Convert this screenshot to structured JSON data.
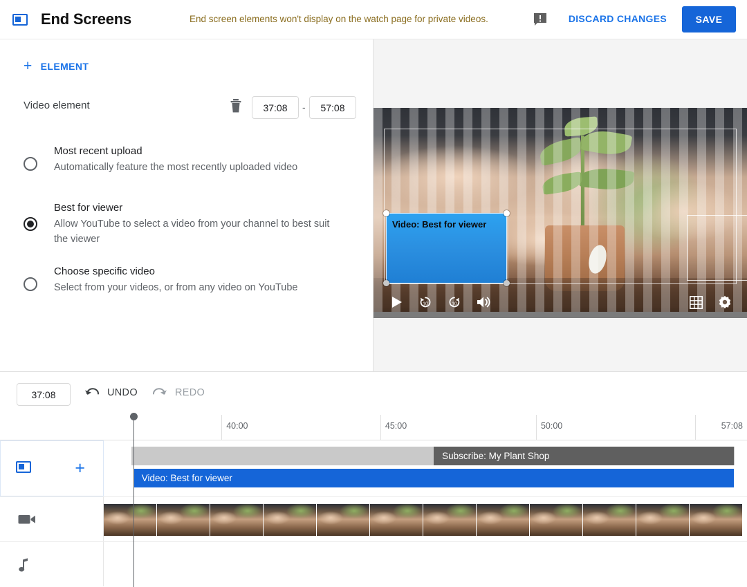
{
  "header": {
    "icon": "end-screen-icon",
    "title": "End Screens",
    "warning_text": "End screen elements won't display on the watch page for private videos.",
    "warning_icon": "comment-alert-icon",
    "discard_label": "DISCARD CHANGES",
    "save_label": "SAVE",
    "accent_color": "#1565d8",
    "warning_color": "#8a6d1f",
    "link_color": "#1a73e8"
  },
  "editor": {
    "add_element_label": "ELEMENT",
    "add_element_icon": "plus-icon",
    "element_name": "Video element",
    "delete_icon": "trash-icon",
    "start_time": "37:08",
    "time_separator": "-",
    "end_time": "57:08",
    "options": [
      {
        "title": "Most recent upload",
        "description": "Automatically feature the most recently uploaded video",
        "selected": false
      },
      {
        "title": "Best for viewer",
        "description": "Allow YouTube to select a video from your channel to best suit the viewer",
        "selected": true
      },
      {
        "title": "Choose specific video",
        "description": "Select from your videos, or from any video on YouTube",
        "selected": false
      }
    ]
  },
  "preview": {
    "selected_element_label": "Video: Best for viewer",
    "selected_element_color": "#2b8fe0",
    "controls_left": [
      "play-icon",
      "replay-10-icon",
      "forward-10-icon",
      "volume-icon"
    ],
    "controls_right": [
      "grid-icon",
      "settings-gear-icon"
    ]
  },
  "timeline": {
    "current_time": "37:08",
    "undo_label": "UNDO",
    "undo_icon": "undo-arrow-icon",
    "redo_label": "REDO",
    "redo_icon": "redo-arrow-icon",
    "ticks": [
      {
        "label": "40:00",
        "left_pct": 18.3
      },
      {
        "label": "45:00",
        "left_pct": 43.0
      },
      {
        "label": "50:00",
        "left_pct": 67.2
      },
      {
        "label": "57:08",
        "left_pct": 91.9
      }
    ],
    "tracks": {
      "elements": {
        "icon": "end-screen-icon",
        "add_icon": "plus-icon",
        "bars": [
          {
            "label": "Subscribe: My Plant Shop",
            "color": "#5f5f5f",
            "left_pct": 51.3,
            "width_pct": 46.7
          },
          {
            "label": "Video: Best for viewer",
            "color": "#1565d8",
            "left_pct": 4.6,
            "width_pct": 93.4
          }
        ]
      },
      "video": {
        "icon": "video-camera-icon",
        "frame_count": 12
      },
      "audio": {
        "icon": "music-note-icon"
      }
    },
    "playhead_position": "37:08"
  }
}
